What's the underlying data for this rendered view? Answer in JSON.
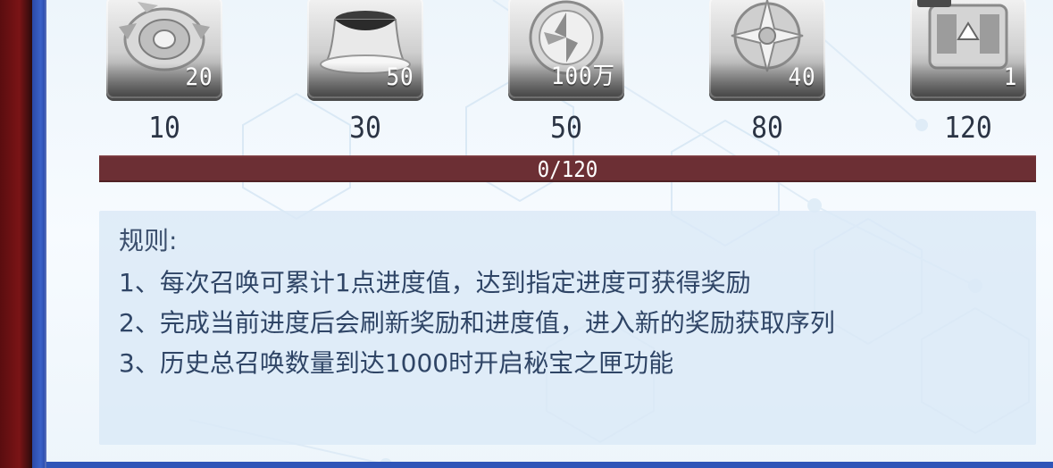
{
  "rewards": [
    {
      "icon": "spinning-top-icon",
      "quantity": "20",
      "milestone": "10"
    },
    {
      "icon": "pudding-icon",
      "quantity": "50",
      "milestone": "30"
    },
    {
      "icon": "silver-coin-icon",
      "quantity": "100万",
      "milestone": "50"
    },
    {
      "icon": "compass-star-emblem-icon",
      "quantity": "40",
      "milestone": "80"
    },
    {
      "icon": "treasure-chest-icon",
      "quantity": "1",
      "milestone": "120"
    }
  ],
  "progress": {
    "text": "0/120",
    "current": 0,
    "max": 120
  },
  "rules": {
    "title": "规则:",
    "lines": [
      "1、每次召唤可累计1点进度值，达到指定进度可获得奖励",
      "2、完成当前进度后会刷新奖励和进度值，进入新的奖励获取序列",
      "3、历史总召唤数量到达1000时开启秘宝之匣功能"
    ]
  },
  "colors": {
    "progress_bg": "#6c2f34",
    "progress_fill": "#e6b84a",
    "panel_bg": "#f3f8fc",
    "border_blue": "#2e55b8",
    "text_dark": "#2b3444",
    "rule_text": "#2f4566"
  }
}
